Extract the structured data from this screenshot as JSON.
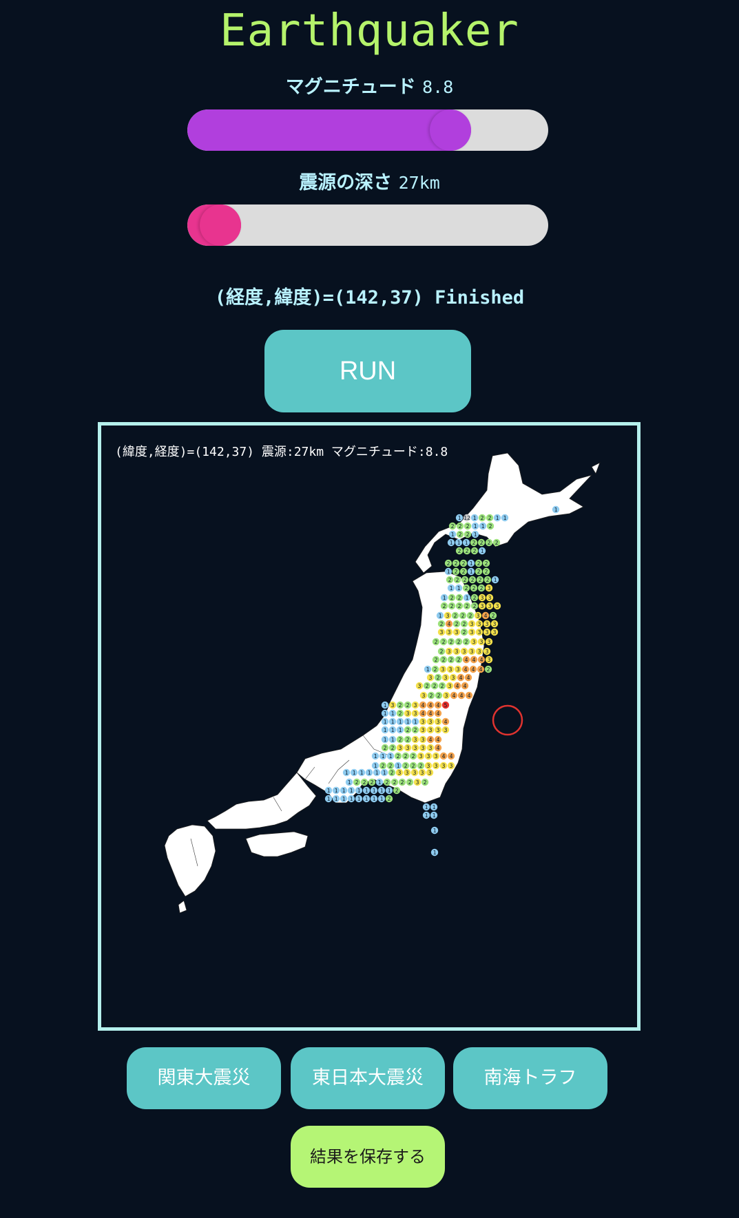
{
  "app": {
    "title": "Earthquaker"
  },
  "magnitude": {
    "label": "マグニチュード",
    "value": "8.8",
    "fraction": 0.72,
    "fill_color": "#b13fdd",
    "thumb_color": "#b13fdd"
  },
  "depth": {
    "label": "震源の深さ",
    "value": "27km",
    "fraction": 0.0,
    "fill_color": "#e8348f",
    "thumb_color": "#e8348f"
  },
  "status": {
    "text": "(経度,緯度)=(142,37) Finished"
  },
  "run_button": {
    "label": "RUN"
  },
  "map": {
    "caption": "(緯度,経度)=(142,37) 震源:27km マグニチュード:8.8",
    "epicenter_color": "#e0332f",
    "intensity_colors": {
      "1": "#8ecbef",
      "2": "#9be07a",
      "3": "#f4e04a",
      "4": "#f2a14b",
      "5": "#e8322b"
    },
    "intensity_rows": [
      "1          ",
      "1 12 1 2 2 1 1 ",
      "2 2 2 1 1 2",
      "1 2 2 1",
      "1 1 1 2 2 2 2 ",
      "2 2 2 1",
      "2 2 2 1 2 2",
      "1 2 2 1 2 2",
      "2 2 2 2 2 2 1",
      "1 1 2 2 2 3",
      "1 2 2 1 2 3 3",
      "2 2 2 2 2 3 3 3",
      "1 3 2 2 2 3 4 2",
      "2 4 2 2 3 3 3 3",
      "3 3 3 2 3 3 3 3",
      "2 2 2 2 2 3 3 3",
      "2 3 3 3 3 3 3",
      "2 2 2 2 4 4 4 3",
      "1 2 3 3 3 4 4 4 2",
      "3 2 3 3 4 4",
      "3 2 2 2 3 4 4",
      "3 2 2 3 4 4 4",
      "1 3 2 2 3 4 4 4 5",
      "1 1 2 3 3 4 4 4",
      "1 1 1 1 1 3 3 3 4",
      "1 1 1 2 2 3 3 3 3",
      "1 1 2 2 3 3 4 4",
      "2 2 3 3 3 3 3 4",
      "1 1 1 2 2 2 3 3 3 4 4",
      "1 2 2 1 2 2 2 3 3 3 3",
      "1 1 1 1 1 1 2 3 3 3 3 3",
      "1 2 2 2 1 2 2 2 2 3 2",
      "1 1 1 1 1 1 1 1 1 2",
      "1 1 1 1 1 1 1 1 2",
      "1 1",
      "1 1",
      "1",
      "1"
    ]
  },
  "presets": [
    {
      "label": "関東大震災"
    },
    {
      "label": "東日本大震災"
    },
    {
      "label": "南海トラフ"
    }
  ],
  "save_button": {
    "label": "結果を保存する"
  }
}
